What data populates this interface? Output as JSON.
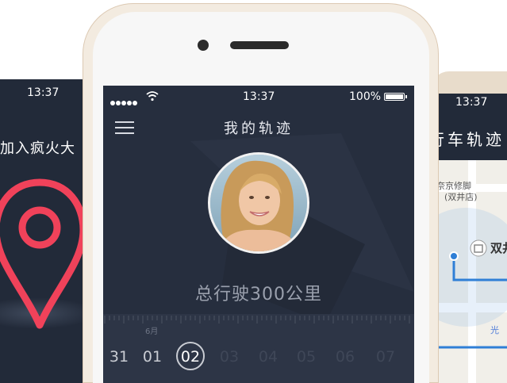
{
  "left_phone": {
    "status_time": "13:37",
    "title": "加入疯火大",
    "pin_color": "#f0425a"
  },
  "center_phone": {
    "status": {
      "time": "13:37",
      "battery": "100%"
    },
    "header": {
      "title": "我的轨迹",
      "menu_icon": "hamburger-menu-icon"
    },
    "profile": {
      "avatar": "user-avatar-photo"
    },
    "summary": {
      "total_distance": "总行驶300公里"
    },
    "timeline": {
      "month": "6月",
      "dates": [
        "31",
        "01",
        "02",
        "03",
        "04",
        "05",
        "06",
        "07"
      ],
      "selected": "02"
    }
  },
  "right_phone": {
    "status_time": "13:37",
    "title": "行车轨迹",
    "map_labels": [
      "奈京修脚",
      "(双井店)",
      "双井",
      "光"
    ],
    "route_color": "#2f7fd6"
  }
}
